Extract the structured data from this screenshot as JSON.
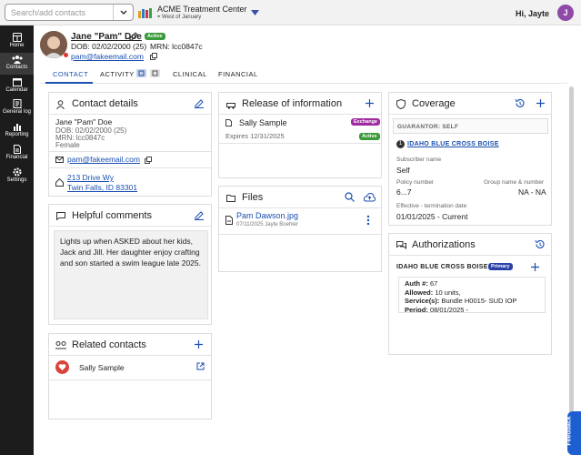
{
  "search": {
    "placeholder": "Search/add contacts"
  },
  "org": {
    "name": "ACME Treatment Center",
    "location": "West of January"
  },
  "user": {
    "greeting": "Hi, Jayte",
    "initial": "J"
  },
  "nav": [
    {
      "label": "Home"
    },
    {
      "label": "Contacts"
    },
    {
      "label": "Calendar"
    },
    {
      "label": "General log"
    },
    {
      "label": "Reporting"
    },
    {
      "label": "Financial"
    },
    {
      "label": "Settings"
    }
  ],
  "patient": {
    "name": "Jane \"Pam\" Doe",
    "status": "Active",
    "dob_line": "DOB: 02/02/2000 (25)",
    "mrn_line": "MRN: lcc0847c",
    "email": "pam@fakeemail.com"
  },
  "tabs": {
    "contact": "CONTACT",
    "activity": "ACTIVITY",
    "clinical": "CLINICAL",
    "financial": "FINANCIAL"
  },
  "contact_details": {
    "title": "Contact details",
    "name": "Jane \"Pam\" Doe",
    "dob": "DOB: 02/02/2000 (25)",
    "mrn": "MRN: lcc0847c",
    "gender": "Female",
    "email": "pam@fakeemail.com",
    "address1": "213 Drive Wy",
    "address2": "Twin Falls, ID 83301"
  },
  "comments": {
    "title": "Helpful comments",
    "text": "Lights up when ASKED about her kids, Jack and Jill.  Her daughter enjoy crafting and son started a swim league late 2025."
  },
  "related": {
    "title": "Related contacts",
    "name": "Sally Sample"
  },
  "release": {
    "title": "Release of information",
    "name": "Sally Sample",
    "badge1": "Exchange",
    "expires": "Expires 12/31/2025",
    "badge2": "Active"
  },
  "files": {
    "title": "Files",
    "filename": "Pam Dawson.jpg",
    "meta": "07/11/2025 Jayte Boehler"
  },
  "coverage": {
    "title": "Coverage",
    "guarantor": "GUARANTOR: SELF",
    "num": "1",
    "insurer": "IDAHO BLUE CROSS BOISE",
    "subscriber_label": "Subscriber name",
    "subscriber": "Self",
    "policy_label": "Policy number",
    "policy": "6...7",
    "group_label": "Group name & number",
    "group": "NA - NA",
    "period_label": "Effective - termination date",
    "period": "01/01/2025 - Current"
  },
  "auth": {
    "title": "Authorizations",
    "insurer": "IDAHO BLUE CROSS BOISE",
    "badge": "Primary",
    "auth_label": "Auth #:",
    "auth_val": "67",
    "allowed_label": "Allowed:",
    "allowed_val": "10 units,",
    "service_label": "Service(s):",
    "service_val": "Bundle H0015- SUD IOP",
    "period_label": "Period:",
    "period_val": "08/01/2025 -"
  },
  "feedback": "Feedback"
}
